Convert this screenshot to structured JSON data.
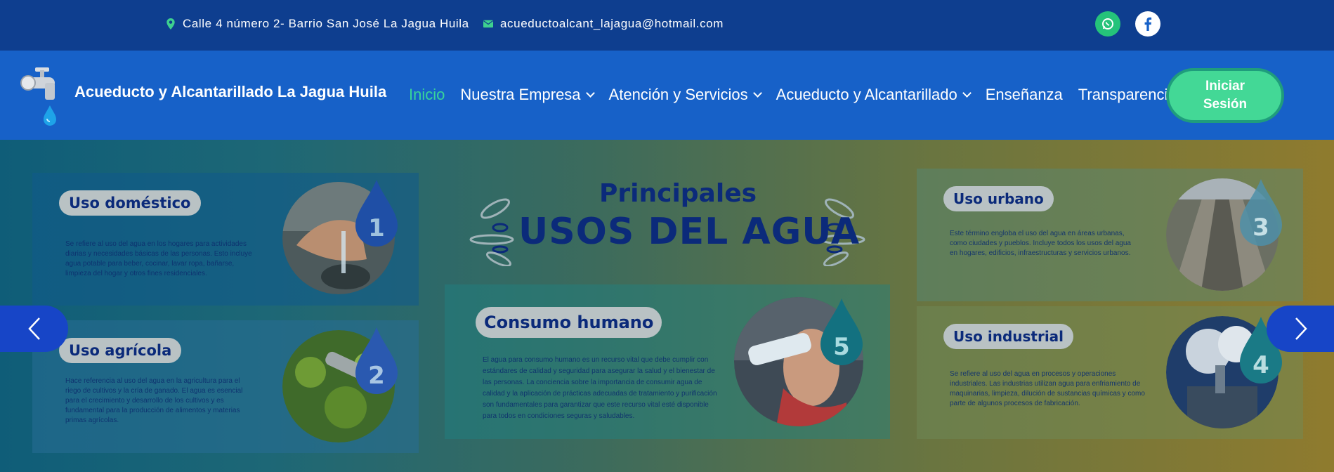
{
  "topbar": {
    "address": "Calle 4 número 2- Barrio San José La Jagua Huila",
    "email": "acueductoalcant_lajagua@hotmail.com",
    "icons": [
      "map-pin-icon",
      "envelope-icon",
      "whatsapp-icon",
      "facebook-icon"
    ]
  },
  "nav": {
    "brand": "Acueducto y Alcantarillado La Jagua Huila",
    "items": [
      {
        "label": "Inicio",
        "active": true,
        "dropdown": false
      },
      {
        "label": "Nuestra Empresa",
        "active": false,
        "dropdown": true
      },
      {
        "label": "Atención y Servicios",
        "active": false,
        "dropdown": true
      },
      {
        "label": "Acueducto y Alcantarillado",
        "active": false,
        "dropdown": true
      },
      {
        "label": "Enseñanza",
        "active": false,
        "dropdown": false
      },
      {
        "label": "Transparencia",
        "active": false,
        "dropdown": false
      }
    ],
    "login": "Iniciar Sesión"
  },
  "hero": {
    "heading_small": "Principales",
    "heading_big": "USOS DEL AGUA",
    "cards": [
      {
        "title": "Uso doméstico",
        "number": "1",
        "text": "Se refiere al uso del agua en los hogares para actividades diarias y necesidades básicas de las personas. Esto incluye agua potable para beber, cocinar, lavar ropa, bañarse, limpieza del hogar y otros fines residenciales."
      },
      {
        "title": "Uso agrícola",
        "number": "2",
        "text": "Hace referencia al uso del agua en la agricultura para el riego de cultivos y la cría de ganado. El agua es esencial para el crecimiento y desarrollo de los cultivos y es fundamental para la producción de alimentos y materias primas agrícolas."
      },
      {
        "title": "Consumo humano",
        "number": "5",
        "text": "El agua para consumo humano es un recurso vital que debe cumplir con estándares de calidad y seguridad para asegurar la salud y el bienestar de las personas. La conciencia sobre la importancia de consumir agua de calidad y la aplicación de prácticas adecuadas de tratamiento y purificación son fundamentales para garantizar que este recurso vital esté disponible para todos en condiciones seguras y saludables."
      },
      {
        "title": "Uso urbano",
        "number": "3",
        "text": "Este término engloba el uso del agua en áreas urbanas, como ciudades y pueblos. Incluye todos los usos del agua en hogares, edificios, infraestructuras y servicios urbanos."
      },
      {
        "title": "Uso industrial",
        "number": "4",
        "text": "Se refiere al uso del agua en procesos y operaciones industriales. Las industrias utilizan agua para enfriamiento de maquinarias, limpieza, dilución de sustancias químicas y como parte de algunos procesos de fabricación."
      }
    ]
  },
  "colors": {
    "topbar": "#0e3e8f",
    "navbar": "#1761c8",
    "accent_green": "#43d896",
    "heading_navy": "#0b2a7a",
    "arrow_blue": "#1745c7"
  }
}
